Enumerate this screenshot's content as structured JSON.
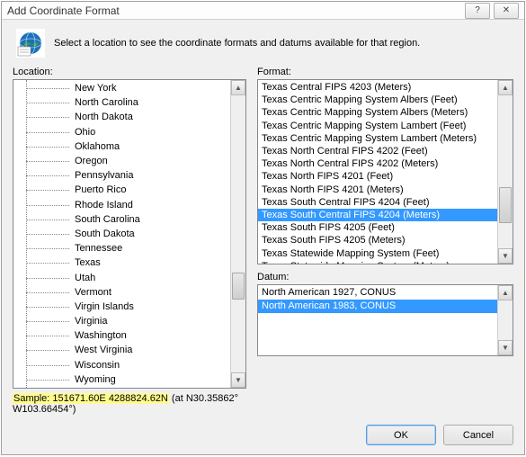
{
  "window": {
    "title": "Add Coordinate Format",
    "help_glyph": "?",
    "close_glyph": "✕"
  },
  "intro": "Select a location to see the coordinate formats and datums available for that region.",
  "labels": {
    "location": "Location:",
    "format": "Format:",
    "datum": "Datum:"
  },
  "locations": [
    "New York",
    "North Carolina",
    "North Dakota",
    "Ohio",
    "Oklahoma",
    "Oregon",
    "Pennsylvania",
    "Puerto Rico",
    "Rhode Island",
    "South Carolina",
    "South Dakota",
    "Tennessee",
    "Texas",
    "Utah",
    "Vermont",
    "Virgin Islands",
    "Virginia",
    "Washington",
    "West Virginia",
    "Wisconsin",
    "Wyoming"
  ],
  "formats": [
    "Texas Central FIPS 4203 (Meters)",
    "Texas Centric Mapping System Albers (Feet)",
    "Texas Centric Mapping System Albers (Meters)",
    "Texas Centric Mapping System Lambert (Feet)",
    "Texas Centric Mapping System Lambert (Meters)",
    "Texas North Central FIPS 4202 (Feet)",
    "Texas North Central FIPS 4202 (Meters)",
    "Texas North FIPS 4201 (Feet)",
    "Texas North FIPS 4201 (Meters)",
    "Texas South Central FIPS 4204 (Feet)",
    "Texas South Central FIPS 4204 (Meters)",
    "Texas South FIPS 4205 (Feet)",
    "Texas South FIPS 4205 (Meters)",
    "Texas Statewide Mapping System (Feet)",
    "Texas Statewide Mapping System (Meters)"
  ],
  "format_selected_index": 10,
  "datums": [
    "North American 1927, CONUS",
    "North American 1983, CONUS"
  ],
  "datum_selected_index": 1,
  "sample": {
    "label": "Sample: ",
    "value": "151671.60E 4288824.62N",
    "suffix": " (at N30.35862° W103.66454°)"
  },
  "buttons": {
    "ok": "OK",
    "cancel": "Cancel"
  },
  "scroll": {
    "up": "▲",
    "down": "▼"
  }
}
